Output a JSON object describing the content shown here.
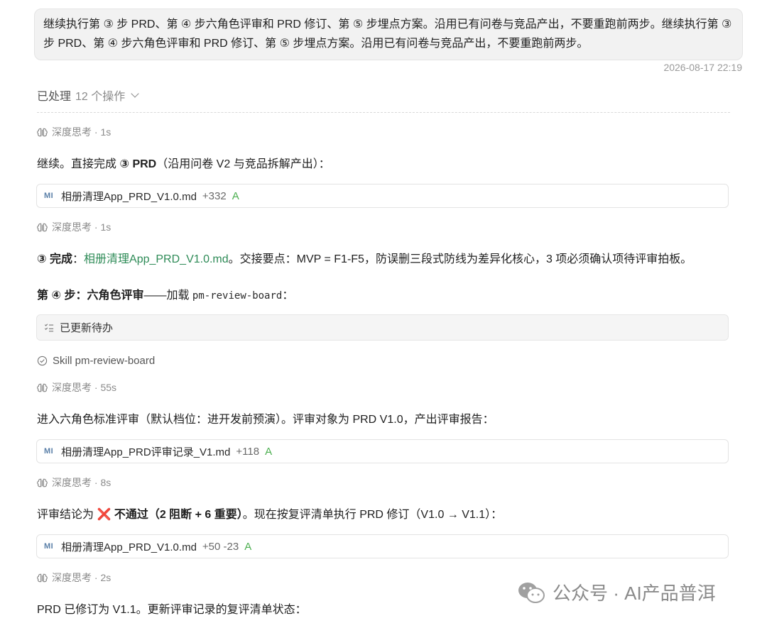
{
  "user_message": "继续执行第 ③ 步 PRD、第 ④ 步六角色评审和 PRD 修订、第 ⑤ 步埋点方案。沿用已有问卷与竞品产出，不要重跑前两步。继续执行第 ③ 步 PRD、第 ④ 步六角色评审和 PRD 修订、第 ⑤ 步埋点方案。沿用已有问卷与竞品产出，不要重跑前两步。",
  "timestamp": "2026-08-17 22:19",
  "processed": {
    "label": "已处理",
    "count": "12 个操作"
  },
  "thinking": [
    {
      "label": "深度思考 · 1s"
    },
    {
      "label": "深度思考 · 1s"
    },
    {
      "label": "深度思考 · 55s"
    },
    {
      "label": "深度思考 · 8s"
    },
    {
      "label": "深度思考 · 2s"
    }
  ],
  "para1": {
    "prefix": "继续。直接完成 ",
    "bold": "③ PRD",
    "suffix": "（沿用问卷 V2 与竞品拆解产出）："
  },
  "file1": {
    "icon": "MI",
    "name": "相册清理App_PRD_V1.0.md",
    "diff": "+332",
    "status": "A"
  },
  "para2": {
    "bold": "③ 完成",
    "colon": "：",
    "link": "相册清理App_PRD_V1.0.md",
    "suffix": "。交接要点：MVP = F1-F5，防误删三段式防线为差异化核心，3 项必须确认项待评审拍板。"
  },
  "para3": {
    "bold": "第 ④ 步：六角色评审",
    "mid": "——加载 ",
    "code": "pm-review-board",
    "suffix": "："
  },
  "todo": {
    "label": "已更新待办"
  },
  "skill": {
    "label": "Skill pm-review-board"
  },
  "para4": {
    "text": "进入六角色标准评审（默认档位：进开发前预演）。评审对象为 PRD V1.0，产出评审报告："
  },
  "file2": {
    "icon": "MI",
    "name": "相册清理App_PRD评审记录_V1.md",
    "diff": "+118",
    "status": "A"
  },
  "para5": {
    "prefix": "评审结论为 ",
    "cross": "❌",
    "bold": " 不通过（2 阻断 + 6 重要）",
    "suffix": "。现在按复评清单执行 PRD 修订（V1.0 → V1.1）："
  },
  "file3": {
    "icon": "MI",
    "name": "相册清理App_PRD_V1.0.md",
    "diff": "+50 -23",
    "status": "A"
  },
  "para6": {
    "text": "PRD 已修订为 V1.1。更新评审记录的复评清单状态："
  },
  "watermark": {
    "text": "公众号 · AI产品普洱"
  }
}
